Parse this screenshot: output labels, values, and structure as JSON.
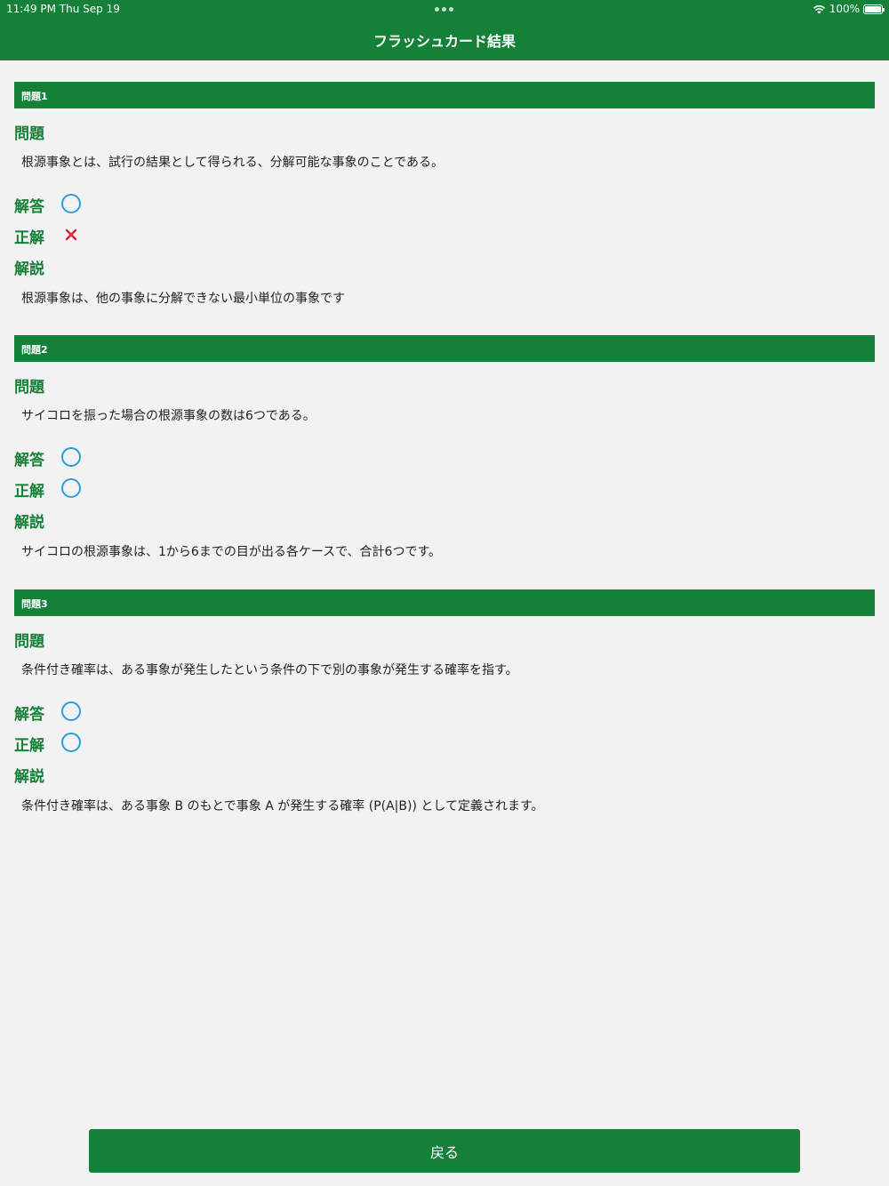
{
  "status_bar": {
    "time_date": "11:49 PM   Thu Sep 19",
    "battery_text": "100%",
    "battery_level": 1.0
  },
  "nav": {
    "title": "フラッシュカード結果"
  },
  "labels": {
    "question": "問題",
    "answer": "解答",
    "correct": "正解",
    "explanation": "解説"
  },
  "colors": {
    "brand_green": "#148038",
    "circle_blue": "#2a9fd6",
    "cross_red": "#e0283a"
  },
  "questions": [
    {
      "header": "問題1",
      "question": "根源事象とは、試行の結果として得られる、分解可能な事象のことである。",
      "answer_mark": "circle",
      "correct_mark": "cross",
      "explanation": "根源事象は、他の事象に分解できない最小単位の事象です"
    },
    {
      "header": "問題2",
      "question": "サイコロを振った場合の根源事象の数は6つである。",
      "answer_mark": "circle",
      "correct_mark": "circle",
      "explanation": "サイコロの根源事象は、1から6までの目が出る各ケースで、合計6つです。"
    },
    {
      "header": "問題3",
      "question": "条件付き確率は、ある事象が発生したという条件の下で別の事象が発生する確率を指す。",
      "answer_mark": "circle",
      "correct_mark": "circle",
      "explanation": "条件付き確率は、ある事象 B のもとで事象 A が発生する確率 (P(A|B)) として定義されます。"
    }
  ],
  "footer": {
    "back_label": "戻る"
  }
}
